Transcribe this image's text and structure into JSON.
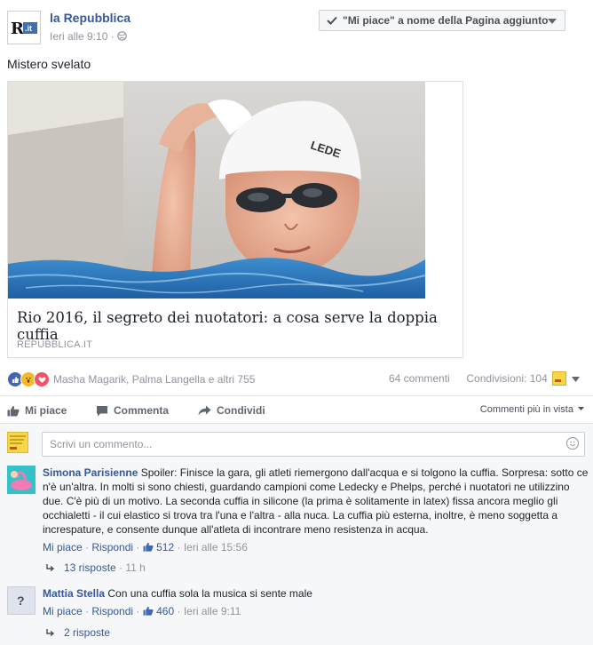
{
  "post": {
    "page_name": "la Repubblica",
    "time": "Ieri alle 9:10",
    "separator": "·",
    "logo_text": "R.it",
    "like_button": "\"Mi piace\" a nome della Pagina aggiunto",
    "text": "Mistero svelato"
  },
  "link_card": {
    "title": "Rio 2016, il segreto dei nuotatori: a cosa serve la doppia cuffia",
    "domain": "REPUBBLICA.IT",
    "cap_text": "LEDE"
  },
  "reactions": {
    "names": "Masha Magarik, Palma Langella e altri 755",
    "comments_count": "64 commenti",
    "shares": "Condivisioni: 104"
  },
  "actions": {
    "like": "Mi piace",
    "comment": "Commenta",
    "share": "Condividi",
    "sort": "Commenti più in vista"
  },
  "comment_input": {
    "placeholder": "Scrivi un commento..."
  },
  "comments": [
    {
      "author": "Simona Parisienne",
      "text": "Spoiler: Finisce la gara, gli atleti riemergono dall'acqua e si tolgono la cuffia. Sorpresa: sotto ce n'è un'altra. In molti si sono chiesti, guardando campioni come Ledecky e Phelps, perché i nuotatori ne utilizzino due. C'è più di un motivo. La seconda cuffia in silicone (la prima è solitamente in latex) fissa ancora meglio gli occhialetti - il cui elastico si trova tra l'una e l'altra - alla nuca. La cuffia più esterna, inoltre, è meno soggetta a increspature, e consente dunque all'atleta di incontrare meno resistenza in acqua.",
      "like": "Mi piace",
      "reply": "Rispondi",
      "likes": "512",
      "time": "Ieri alle 15:56",
      "replies": "13 risposte",
      "replies_time": "11 h"
    },
    {
      "author": "Mattia Stella",
      "text": "Con una cuffia sola la musica si sente male",
      "like": "Mi piace",
      "reply": "Rispondi",
      "likes": "460",
      "time": "Ieri alle 9:11",
      "replies": "2 risposte",
      "replies_time": ""
    }
  ],
  "colors": {
    "link": "#365899",
    "muted": "#90949c",
    "background_comments": "#f6f7f9",
    "accent_like": "#4267b2"
  }
}
